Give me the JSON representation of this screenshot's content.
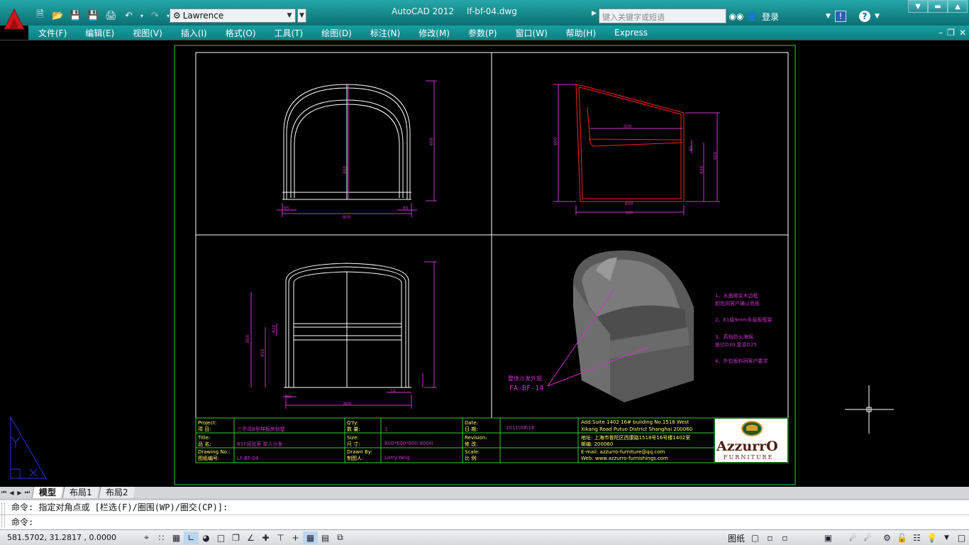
{
  "app": {
    "logo_letter": "A",
    "title": "AutoCAD 2012",
    "filename": "lf-bf-04.dwg",
    "workspace": "Lawrence",
    "search_placeholder": "键入关键字或短语",
    "login_label": "登录"
  },
  "menu": [
    "文件(F)",
    "编辑(E)",
    "视图(V)",
    "插入(I)",
    "格式(O)",
    "工具(T)",
    "绘图(D)",
    "标注(N)",
    "修改(M)",
    "参数(P)",
    "窗口(W)",
    "帮助(H)",
    "Express"
  ],
  "tabs": [
    "模型",
    "布局1",
    "布局2"
  ],
  "command": {
    "history": "命令: 指定对角点或 [栏选(F)/圈围(WP)/圈交(CP)]:",
    "prompt": "命令:"
  },
  "status": {
    "coords": "581.5702,  31.2817  , 0.0000",
    "paper_label": "图纸"
  },
  "drawing": {
    "dims_front": [
      "800",
      "600",
      "800",
      "65",
      "65"
    ],
    "dims_side": [
      "800",
      "500",
      "500",
      "600",
      "450",
      "600",
      "80"
    ],
    "dims_back": [
      "800",
      "450",
      "420",
      "800",
      "65",
      "10"
    ],
    "callout_label": "整体沙发外观",
    "callout_code": "FA-BF-14",
    "notes": [
      "1、水曲柳实木边框",
      "颜色同客户确认色板",
      "2、E1级9mm多层板框架",
      "3、高档防火海绵,",
      "座位D30,靠背D25",
      "4、外包面料同客户要求"
    ],
    "title_block": {
      "project_label": "Project:",
      "project_label_cn": "项   目:",
      "project_value": "三亭湾B型样板房别墅",
      "qty_label": "Q'ty:",
      "qty_label_cn": "数   量:",
      "qty_value": "1",
      "date_label": "Date:",
      "date_label_cn": "日   期:",
      "date_value": "2011\\08\\16",
      "title_label": "Title:",
      "title_label_cn": "品   名:",
      "title_value": "B1F阅览室    单人沙发",
      "size_label": "Size:",
      "size_label_cn": "尺   寸:",
      "size_value": "800*600*600-800H",
      "revision_label": "Revision:",
      "revision_label_cn": "修   改:",
      "drawing_no_label": "Drawing No.:",
      "drawing_no_label_cn": "图纸编号:",
      "drawing_no_value": "LF-BF-04",
      "drawn_by_label": "Drawn By:",
      "drawn_by_label_cn": "制图人:",
      "drawn_by_value": "Larry.Yang",
      "scale_label": "Scale:",
      "scale_label_cn": "比   例:",
      "address_en1": "Add:Suite 1402 16# building No.1518 West",
      "address_en2": "Xikang Road Putuo District Shanghai 200060",
      "address_cn": "地址: 上海市普陀区西康路1518号16号楼1402室",
      "postcode": "邮编:  200060",
      "email": "E-mail: azzurro-furniture@qq.com",
      "web": "Web: www.azzurro-furnishings.com",
      "logo_text": "AzzurrO",
      "logo_sub": "FURNITURE"
    }
  },
  "colors": {
    "title_gradient_top": "#25a7a7",
    "title_gradient_bottom": "#0a6f73",
    "dimension": "#cc33cc",
    "outline_white": "#ffffff",
    "side_profile": "#ff2020",
    "frame_green": "#33cc33",
    "ucs_blue": "#2233dd"
  }
}
